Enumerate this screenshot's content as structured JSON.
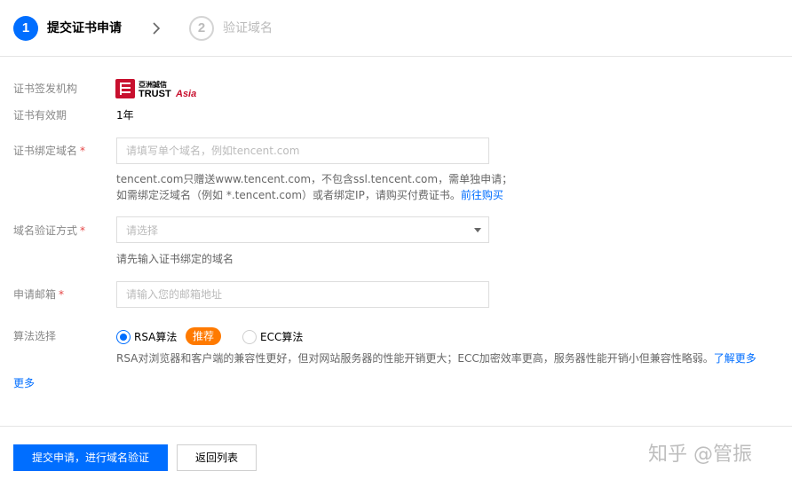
{
  "steps": [
    {
      "number": "1",
      "label": "提交证书申请",
      "active": true
    },
    {
      "number": "2",
      "label": "验证域名",
      "active": false
    }
  ],
  "form": {
    "issuer": {
      "label": "证书签发机构",
      "logo_text": "亞洲誠信 TRUSTAsia"
    },
    "validity": {
      "label": "证书有效期",
      "value": "1年"
    },
    "domain": {
      "label": "证书绑定域名",
      "placeholder": "请填写单个域名，例如tencent.com",
      "value": "",
      "help_line1": "tencent.com只赠送www.tencent.com，不包含ssl.tencent.com，需单独申请；",
      "help_line2": "如需绑定泛域名（例如 *.tencent.com）或者绑定IP，请购买付费证书。",
      "help_link": "前往购买"
    },
    "verify_method": {
      "label": "域名验证方式",
      "placeholder": "请选择",
      "help": "请先输入证书绑定的域名"
    },
    "email": {
      "label": "申请邮箱",
      "placeholder": "请输入您的邮箱地址",
      "value": ""
    },
    "algorithm": {
      "label": "算法选择",
      "options": [
        {
          "label": "RSA算法",
          "checked": true
        },
        {
          "label": "ECC算法",
          "checked": false
        }
      ],
      "badge": "推荐",
      "help": "RSA对浏览器和客户端的兼容性更好，但对网站服务器的性能开销更大；ECC加密效率更高，服务器性能开销小但兼容性略弱。",
      "help_link": "了解更多"
    },
    "more_link": "更多",
    "required_mark": "*"
  },
  "footer": {
    "submit_label": "提交申请，进行域名验证",
    "back_label": "返回列表"
  },
  "watermark": "知乎 @管振",
  "colors": {
    "primary": "#006eff",
    "badge": "#ff7a00",
    "required": "#e54545"
  }
}
